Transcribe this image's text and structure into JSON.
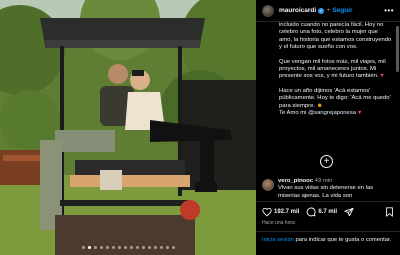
{
  "post": {
    "username": "mauroicardi",
    "separator": "•",
    "follow_label": "Seguir",
    "more_label": "•••",
    "caption_paragraphs": [
      "incluido cuando no parecía fácil. Hoy no celebro una foto, celebro la mujer que amo, la historia que estamos construyendo y el futuro que sueño con vos.",
      "Que vengan mil fotos más, mil viajes, mil proyectos, mil amaneceres juntos. Mi presente sos vos, y mi futuro también.",
      "Hace un año dijimos 'Acá estamos' públicamente. Hoy te digo: 'Acá me quedo' para siempre.",
      "Te Amo mi"
    ],
    "caption_emoji_heart": "♥",
    "caption_emoji_face": "☻",
    "mention": "@sangrejaponesa",
    "load_more_label": "+",
    "slide_count": 16,
    "active_slide": 1
  },
  "comment": {
    "user": "vero_pinooc",
    "time": "49 min",
    "text": "Vivan sus vidas sin detenerse en las miserias ajenas. La vida son"
  },
  "actions": {
    "likes": "192.7 mil",
    "comments": "6.7 mil"
  },
  "time_ago": "Hace una hora",
  "login": {
    "link_label": "Inicia sesión",
    "text": " para indicar que te gusta o comentar."
  },
  "colors": {
    "link_blue": "#0095f6",
    "background": "#000000",
    "heart_red": "#ed4956"
  }
}
